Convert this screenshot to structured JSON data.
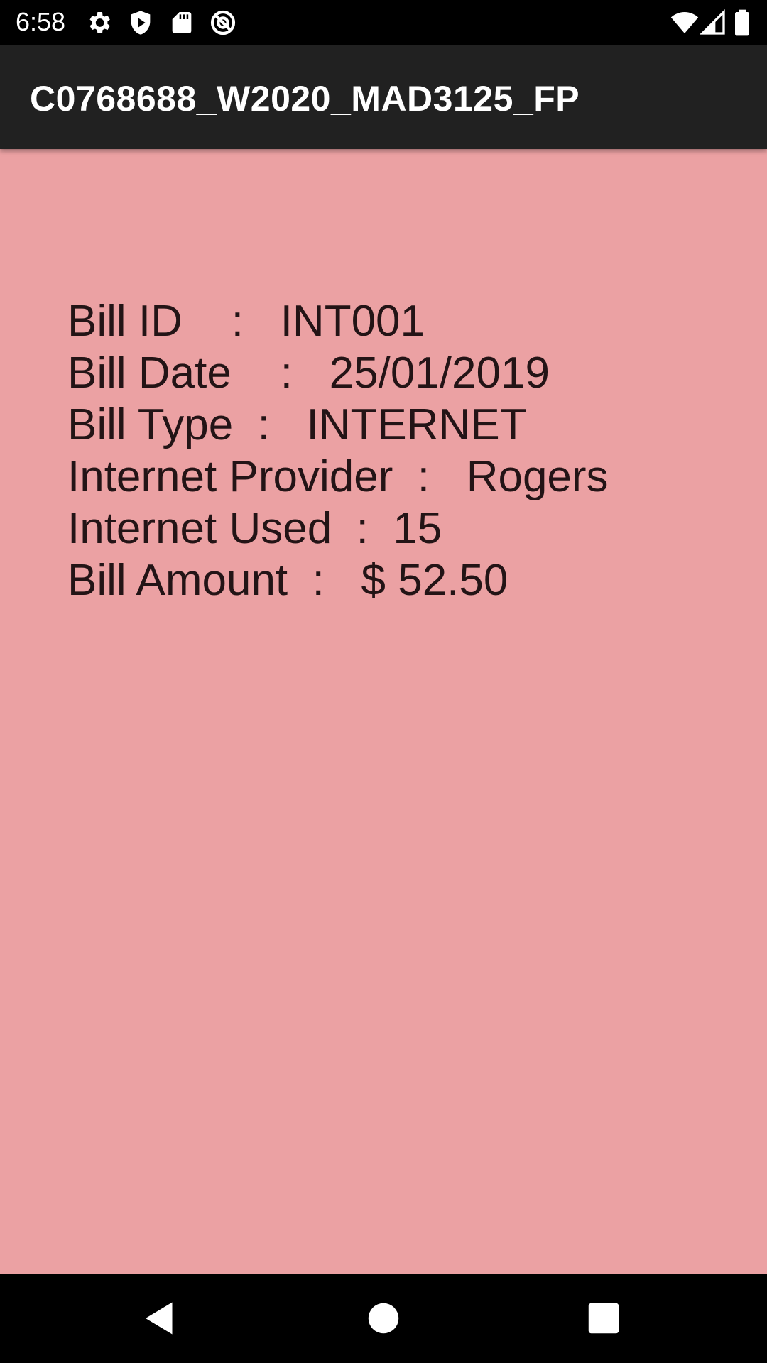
{
  "status_bar": {
    "time": "6:58",
    "icons": [
      "settings-icon",
      "shield-play-icon",
      "sd-card-icon",
      "at-sign-icon",
      "wifi-icon",
      "cellular-signal-icon",
      "battery-icon"
    ]
  },
  "app_bar": {
    "title": "C0768688_W2020_MAD3125_FP"
  },
  "bill_details": {
    "lines": [
      "Bill ID    :   INT001",
      "Bill Date    :   25/01/2019",
      "Bill Type  :   INTERNET",
      "Internet Provider  :   Rogers",
      "Internet Used  :  15",
      "Bill Amount  :   $ 52.50"
    ]
  },
  "nav_bar": {
    "buttons": [
      "back-icon",
      "home-icon",
      "recents-icon"
    ]
  },
  "colors": {
    "content_background": "#EBA1A3",
    "app_bar_background": "#212121",
    "text_color": "#231416"
  }
}
